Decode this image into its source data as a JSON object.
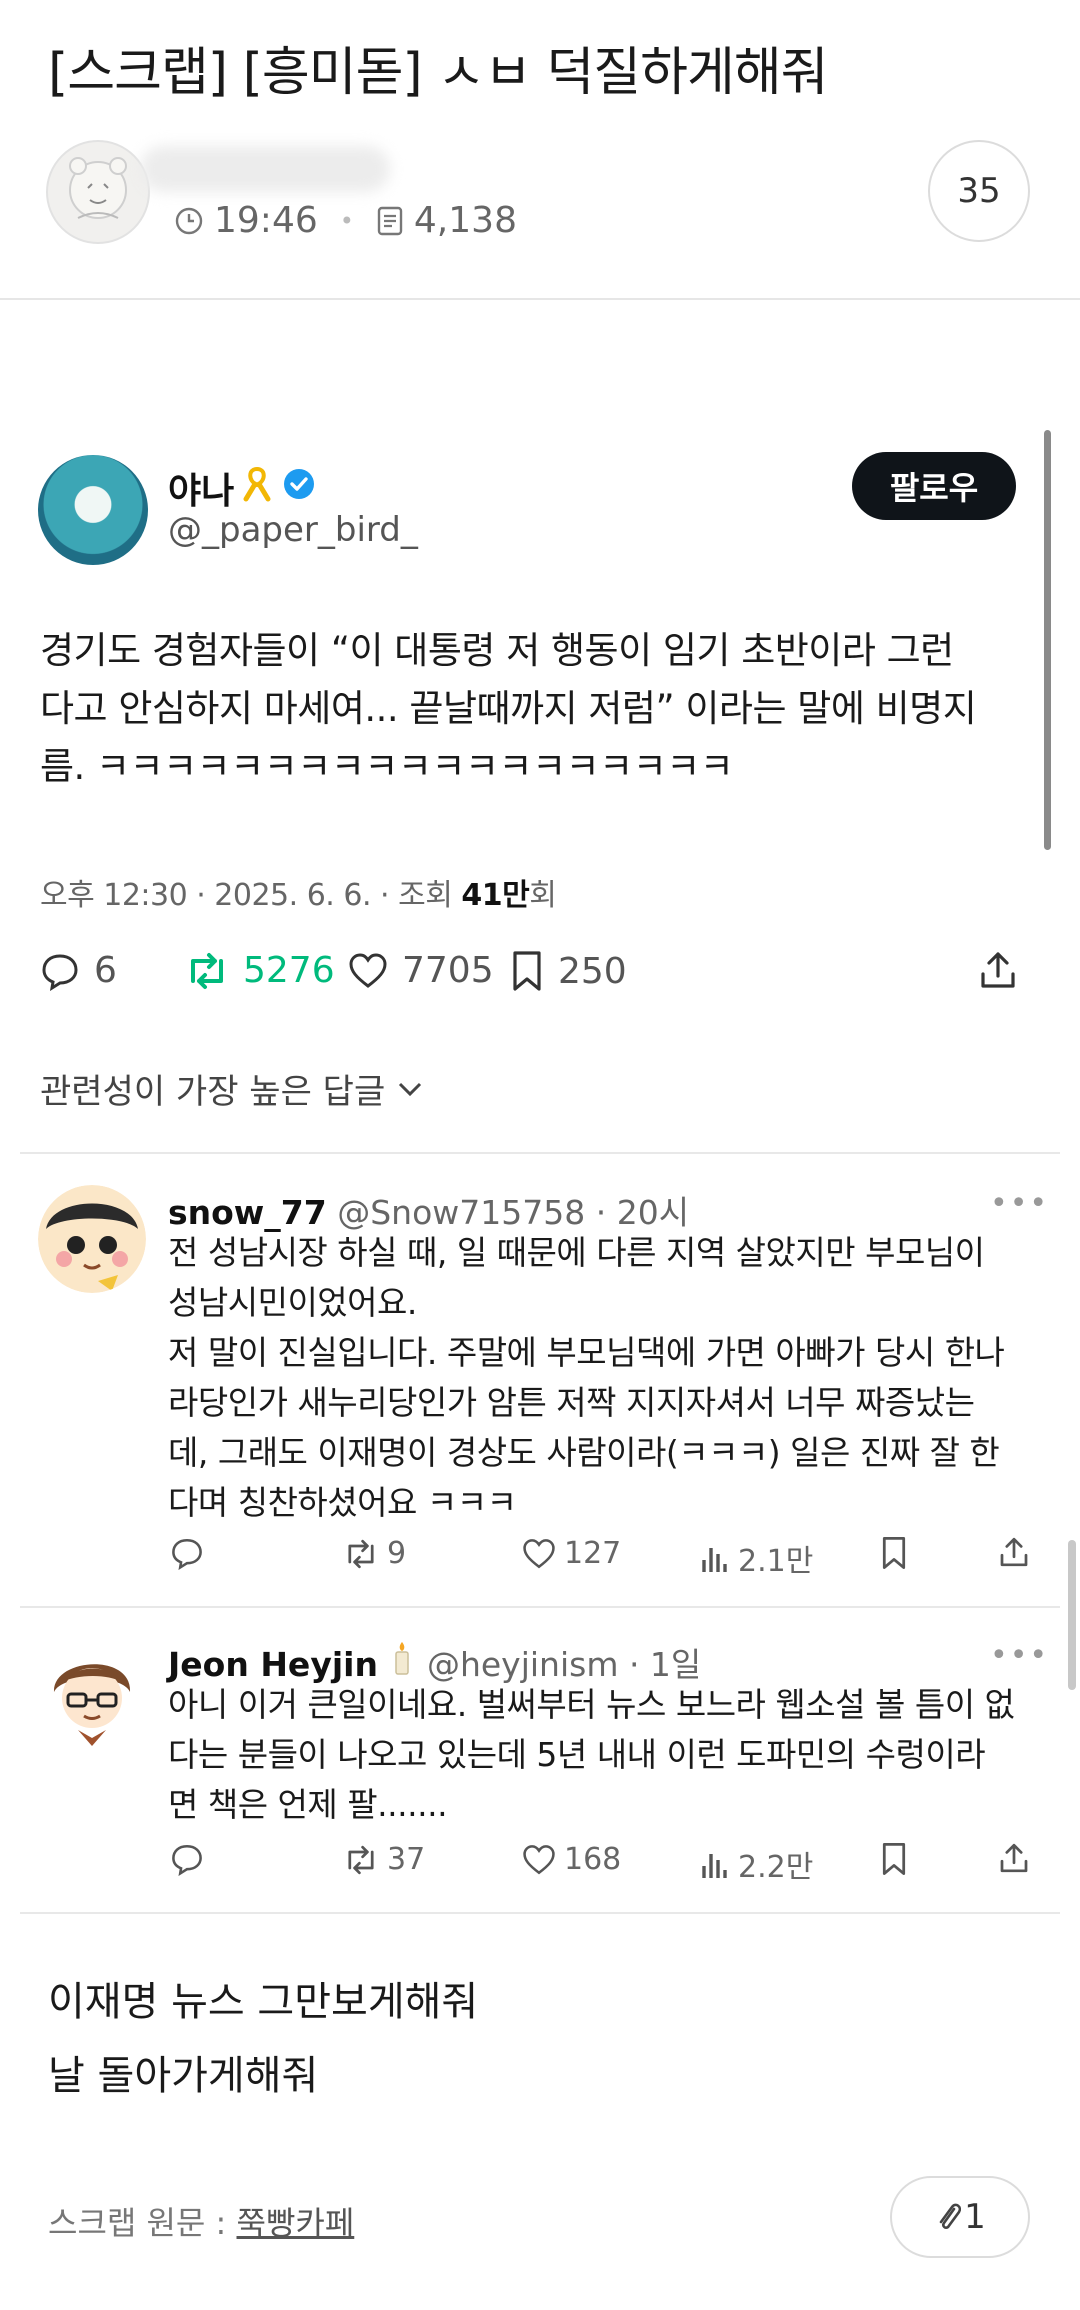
{
  "post": {
    "title": "[스크랩] [흥미돋] ㅅㅂ 덕질하게해줘",
    "time": "19:46",
    "views": "4,138",
    "comment_count": "35"
  },
  "tweet": {
    "name": "야나",
    "handle": "@_paper_bird_",
    "follow_label": "팔로우",
    "body_lines": [
      "경기도 경험자들이 “이 대통령 저 행동이 임기 초반이라 그런",
      "다고 안심하지 마세여... 끝날때까지 저럼” 이라는 말에 비명지",
      "름. ㅋㅋㅋㅋㅋㅋㅋㅋㅋㅋㅋㅋㅋㅋㅋㅋㅋㅋㅋ"
    ],
    "meta_prefix": "오후 12:30 · 2025. 6. 6. · 조회 ",
    "meta_views": "41만",
    "meta_suffix": "회",
    "replies": "6",
    "retweets": "5276",
    "likes": "7705",
    "bookmarks": "250",
    "retweet_color": "#00ba7c",
    "verified_color": "#1d9bf0"
  },
  "relevance_label": "관련성이 가장 높은 답글",
  "replies": [
    {
      "name": "snow_77",
      "handle": "@Snow715758 · 20시",
      "lines": [
        "전 성남시장 하실 때, 일 때문에 다른 지역 살았지만 부모님이",
        "성남시민이었어요.",
        "저 말이 진실입니다. 주말에 부모님댁에 가면 아빠가 당시 한나",
        "라당인가 새누리당인가 암튼 저짝 지지자셔서 너무 짜증났는",
        "데, 그래도 이재명이 경상도 사람이라(ㅋㅋㅋ) 일은 진짜 잘 한",
        "다며 칭찬하셨어요 ㅋㅋㅋ"
      ],
      "retweets": "9",
      "likes": "127",
      "views": "2.1만"
    },
    {
      "name": "Jeon Heyjin",
      "handle": "@heyjinism · 1일",
      "lines": [
        "아니 이거 큰일이네요. 벌써부터 뉴스 보느라 웹소설 볼 틈이 없",
        "다는 분들이 나오고 있는데 5년 내내 이런 도파민의 수렁이라",
        "면 책은 언제 팔......."
      ],
      "retweets": "37",
      "likes": "168",
      "views": "2.2만"
    }
  ],
  "closing_lines": [
    "이재명 뉴스 그만보게해줘",
    "날 돌아가게해줘"
  ],
  "source": {
    "label": "스크랩 원문 : ",
    "link": "쭉빵카페"
  },
  "attachment_count": "1"
}
